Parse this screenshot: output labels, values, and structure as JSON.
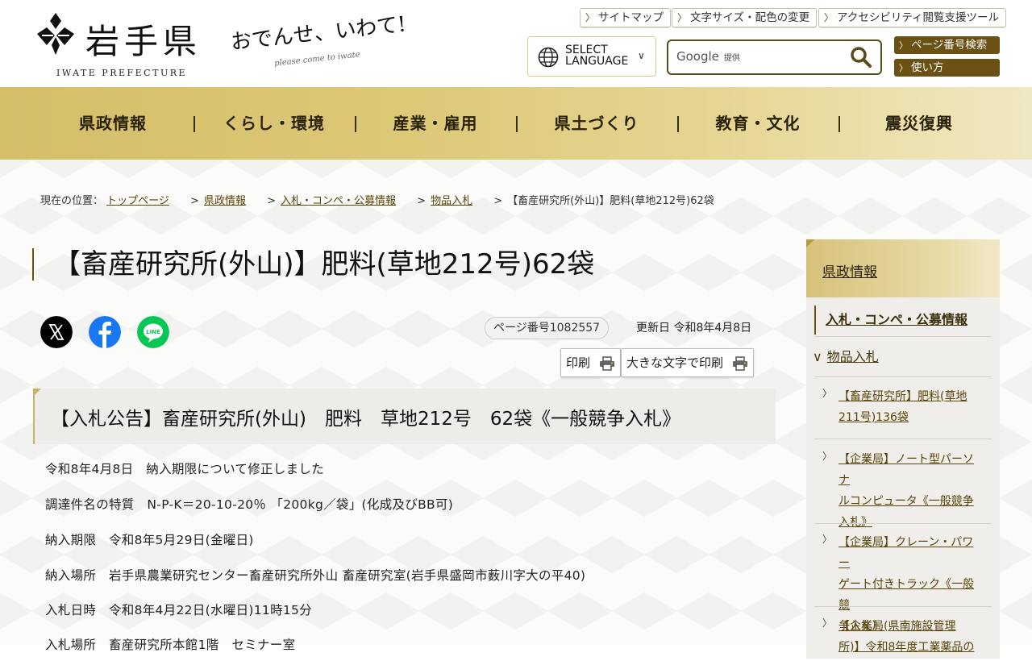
{
  "header": {
    "logo_name": "岩手県",
    "logo_en": "IWATE PREFECTURE",
    "catch_main": "おでんせ、いわて!",
    "catch_sub": "please come to iwate",
    "links": [
      "サイトマップ",
      "文字サイズ・配色の変更",
      "アクセシビリティ閲覧支援ツール"
    ],
    "language_line1": "SELECT",
    "language_line2": "LANGUAGE",
    "search_brand": "Google",
    "search_brand_note": "提供",
    "page_search": "ページ番号検索",
    "usage": "使い方"
  },
  "nav": [
    "県政情報",
    "くらし・環境",
    "産業・雇用",
    "県土づくり",
    "教育・文化",
    "震災復興"
  ],
  "breadcrumb": {
    "label": "現在の位置：",
    "items": [
      "トップページ",
      "県政情報",
      "入札・コンペ・公募情報",
      "物品入札"
    ],
    "current": "【畜産研究所(外山)】肥料(草地212号)62袋"
  },
  "page": {
    "title": "【畜産研究所(外山)】肥料(草地212号)62袋",
    "page_number": "ページ番号1082557",
    "updated": "更新日 令和8年4月8日",
    "print": "印刷",
    "print_large": "大きな文字で印刷",
    "h2": "【入札公告】畜産研究所(外山)　肥料　草地212号　62袋《一般競争入札》",
    "paragraphs": [
      "令和8年4月8日　納入期限について修正しました",
      "調達件名の特質　N-P-K＝20-10-20％ 「200kg／袋」(化成及びBB可)",
      "納入期限　令和8年5月29日(金曜日)",
      "納入場所　岩手県農業研究センター畜産研究所外山 畜産研究室(岩手県盛岡市薮川字大の平40)",
      "入札日時　令和8年4月22日(水曜日)11時15分",
      "入札場所　畜産研究所本館1階　セミナー室"
    ]
  },
  "side": {
    "head": "県政情報",
    "level2": "入札・コンペ・公募情報",
    "level3": "物品入札",
    "items": [
      [
        "【畜産研究所】肥料(草地",
        "211号)136袋"
      ],
      [
        "【企業局】ノート型パーソナ",
        "ルコンピュータ《一般競争",
        "入札》"
      ],
      [
        "【企業局】クレーン・パワー",
        "ゲート付きトラック《一般競",
        "争入札》"
      ],
      [
        "【企業局(県南施設管理",
        "所)】令和8年度工業薬品の"
      ]
    ]
  },
  "colors": {
    "brand_brown": "#6b5113",
    "nav_gold": "#d4be6a",
    "x_black": "#000000",
    "facebook_blue": "#1877f2",
    "line_green": "#06c755"
  },
  "icons": [
    "iwate-emblem-icon",
    "chevron-right-icon",
    "globe-icon",
    "chevron-down-icon",
    "search-icon",
    "x-icon",
    "facebook-icon",
    "line-icon",
    "printer-icon"
  ]
}
